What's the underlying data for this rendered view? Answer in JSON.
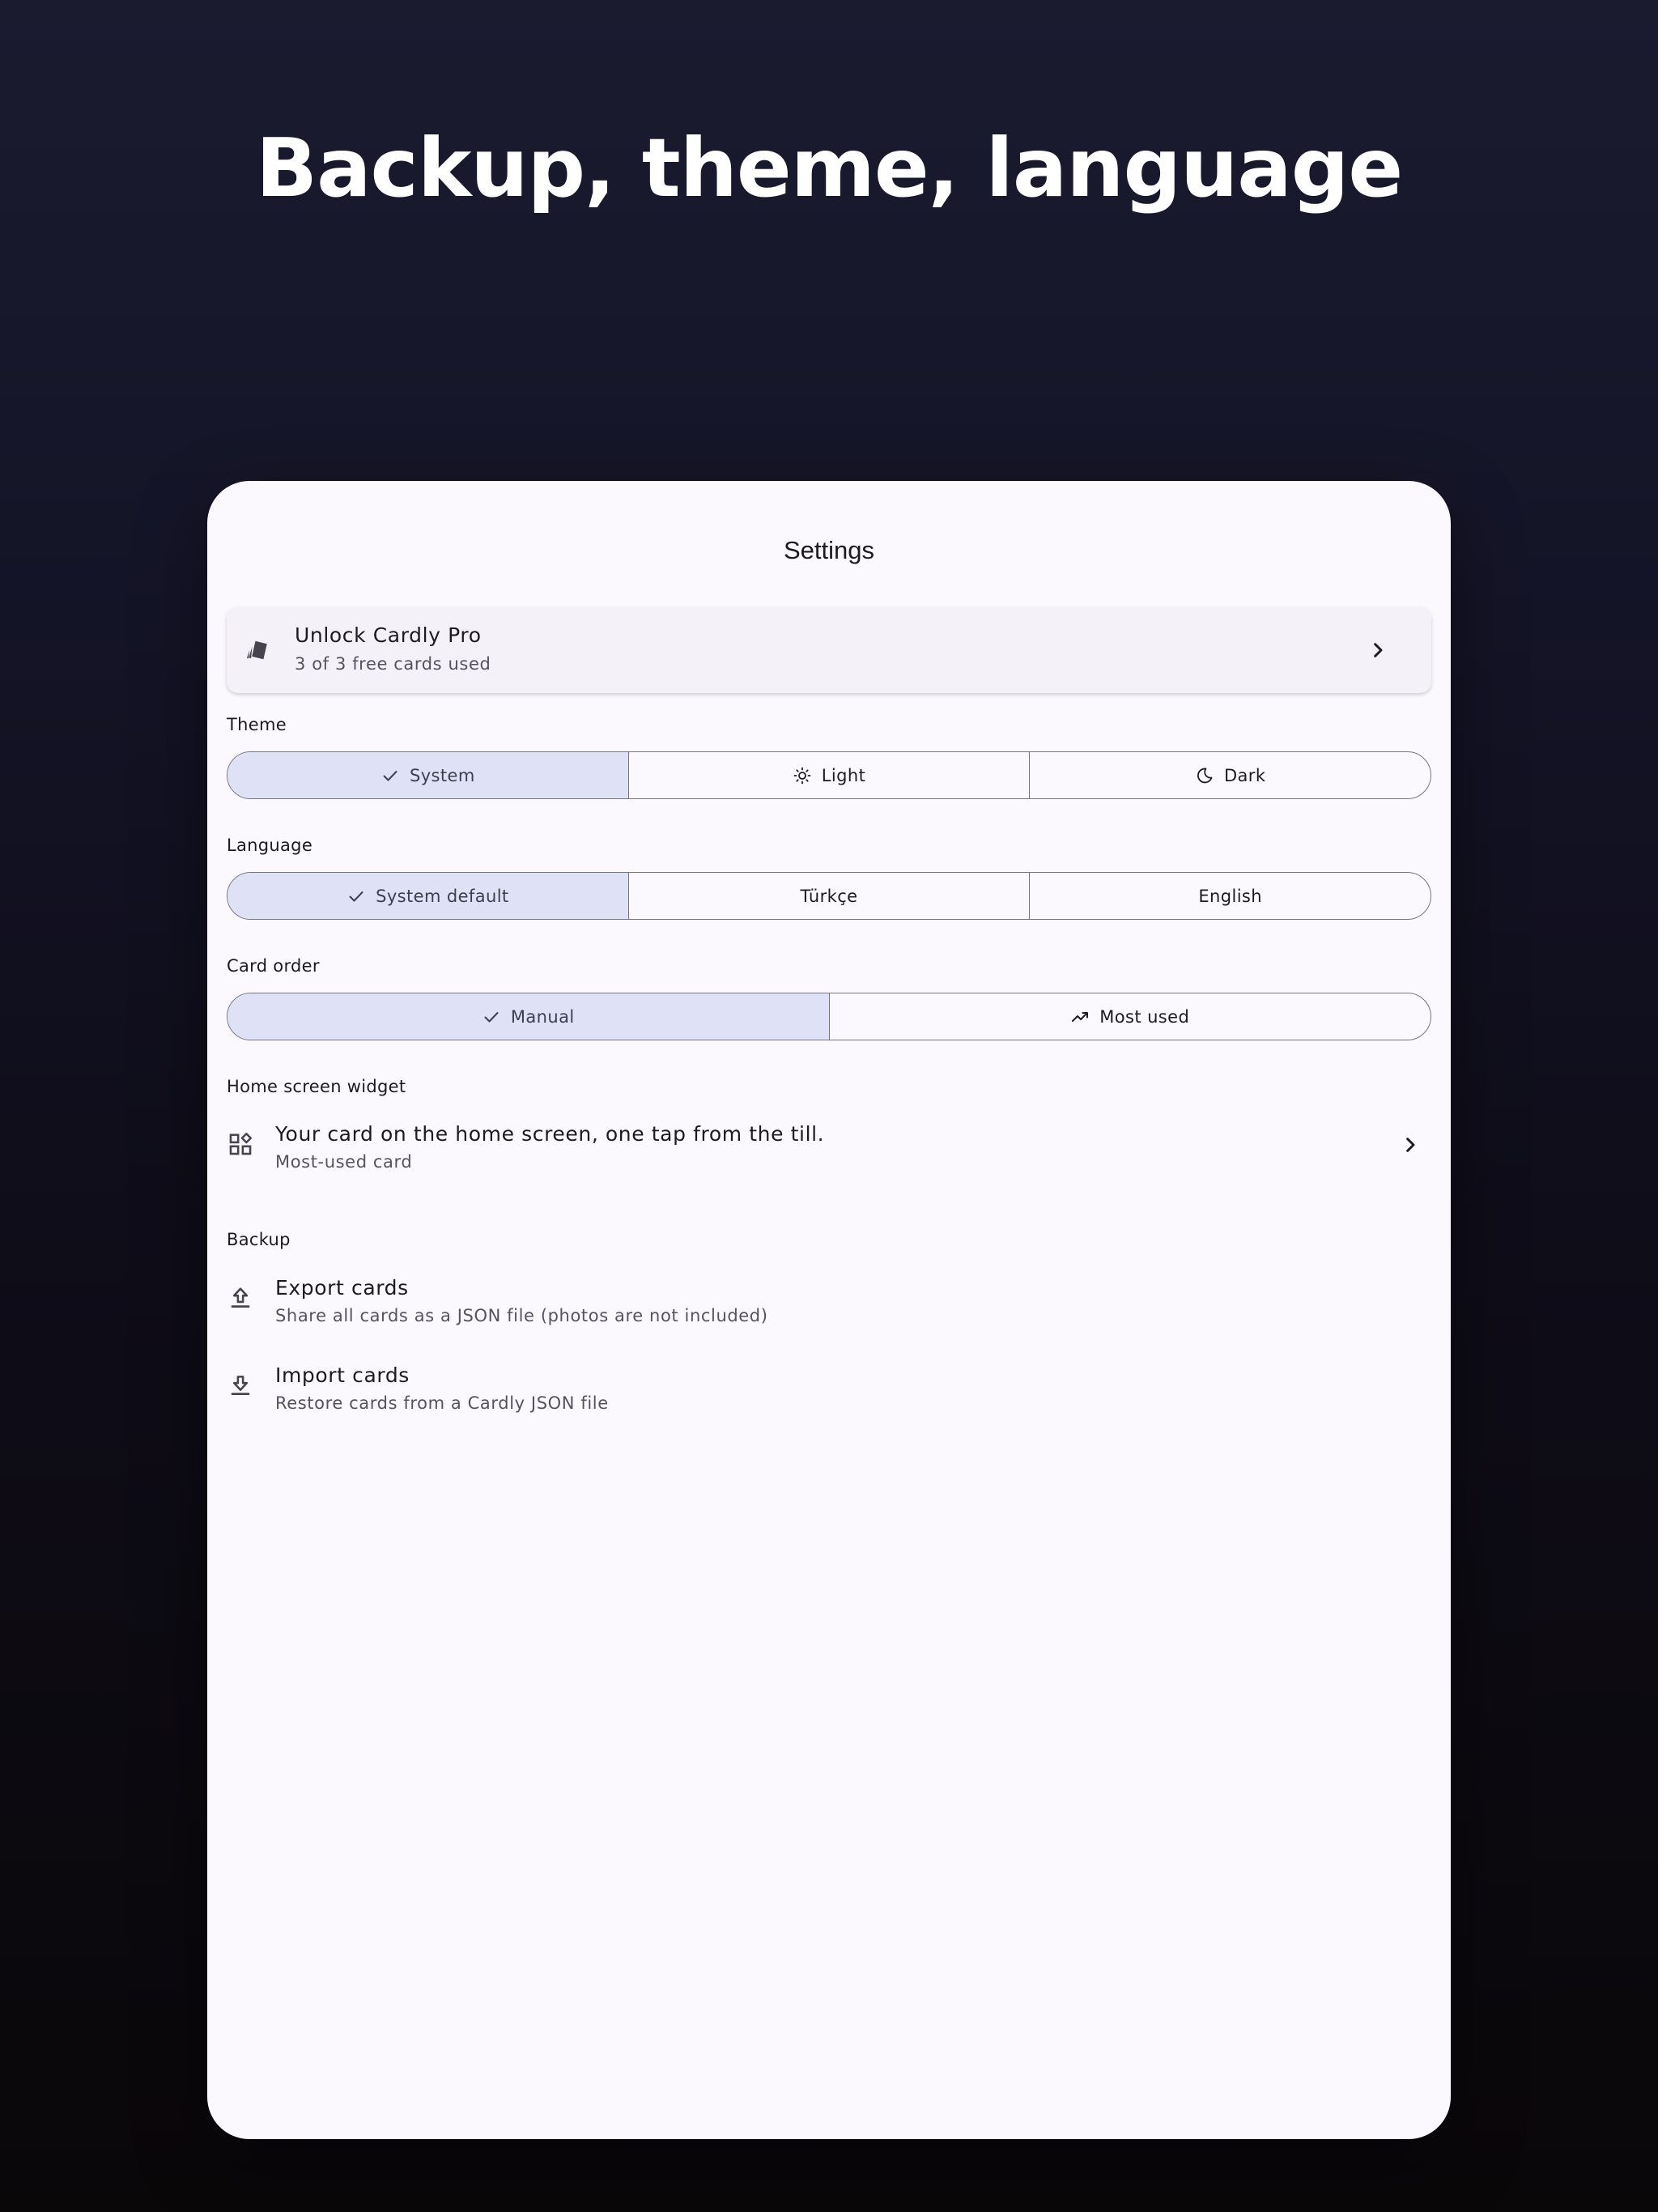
{
  "headline": "Backup, theme, language",
  "screen": {
    "title": "Settings"
  },
  "pro_card": {
    "title": "Unlock Cardly Pro",
    "subtitle": "3 of 3 free cards used",
    "icon": "cards-icon"
  },
  "theme": {
    "label": "Theme",
    "options": [
      {
        "label": "System",
        "icon": "check-icon",
        "selected": true
      },
      {
        "label": "Light",
        "icon": "sun-icon",
        "selected": false
      },
      {
        "label": "Dark",
        "icon": "moon-icon",
        "selected": false
      }
    ]
  },
  "language": {
    "label": "Language",
    "options": [
      {
        "label": "System default",
        "icon": "check-icon",
        "selected": true
      },
      {
        "label": "Türkçe",
        "selected": false
      },
      {
        "label": "English",
        "selected": false
      }
    ]
  },
  "card_order": {
    "label": "Card order",
    "options": [
      {
        "label": "Manual",
        "icon": "check-icon",
        "selected": true
      },
      {
        "label": "Most used",
        "icon": "trending-up-icon",
        "selected": false
      }
    ]
  },
  "widget": {
    "label": "Home screen widget",
    "title": "Your card on the home screen, one tap from the till.",
    "subtitle": "Most-used card",
    "icon": "widgets-icon"
  },
  "backup": {
    "label": "Backup",
    "export": {
      "title": "Export cards",
      "subtitle": "Share all cards as a JSON file (photos are not included)",
      "icon": "upload-icon"
    },
    "import": {
      "title": "Import cards",
      "subtitle": "Restore cards from a Cardly JSON file",
      "icon": "download-icon"
    }
  },
  "colors": {
    "selected_segment": "#dfe1f6",
    "surface": "#fbf8fe",
    "outline": "#77757f"
  }
}
